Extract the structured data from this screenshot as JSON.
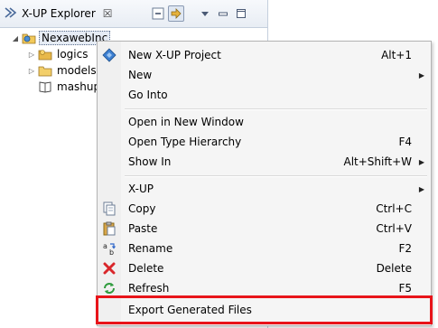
{
  "view": {
    "title": "X-UP Explorer",
    "close_glyph": "☒"
  },
  "tree": {
    "root": "NexawebInc",
    "children": [
      "logics",
      "models",
      "mashup"
    ]
  },
  "menu": {
    "items": [
      {
        "label": "New X-UP Project",
        "accel": "Alt+1",
        "icon": "xup-project-icon"
      },
      {
        "label": "New",
        "accel": "",
        "submenu": true
      },
      {
        "label": "Go Into",
        "accel": ""
      },
      {
        "label": "Open in New Window",
        "accel": ""
      },
      {
        "label": "Open Type Hierarchy",
        "accel": "F4"
      },
      {
        "label": "Show In",
        "accel": "Alt+Shift+W",
        "submenu": true
      },
      {
        "label": "X-UP",
        "accel": "",
        "submenu": true
      },
      {
        "label": "Copy",
        "accel": "Ctrl+C",
        "icon": "copy-icon"
      },
      {
        "label": "Paste",
        "accel": "Ctrl+V",
        "icon": "paste-icon"
      },
      {
        "label": "Rename",
        "accel": "F2",
        "icon": "rename-icon"
      },
      {
        "label": "Delete",
        "accel": "Delete",
        "icon": "delete-icon"
      },
      {
        "label": "Refresh",
        "accel": "F5",
        "icon": "refresh-icon"
      },
      {
        "label": "Export Generated Files",
        "accel": "",
        "highlighted": true
      }
    ]
  },
  "colors": {
    "highlight_box": "#e8141a",
    "delete_icon": "#d9262a",
    "refresh_icon": "#2e9b3c",
    "folder_icon": "#e8b84a"
  }
}
